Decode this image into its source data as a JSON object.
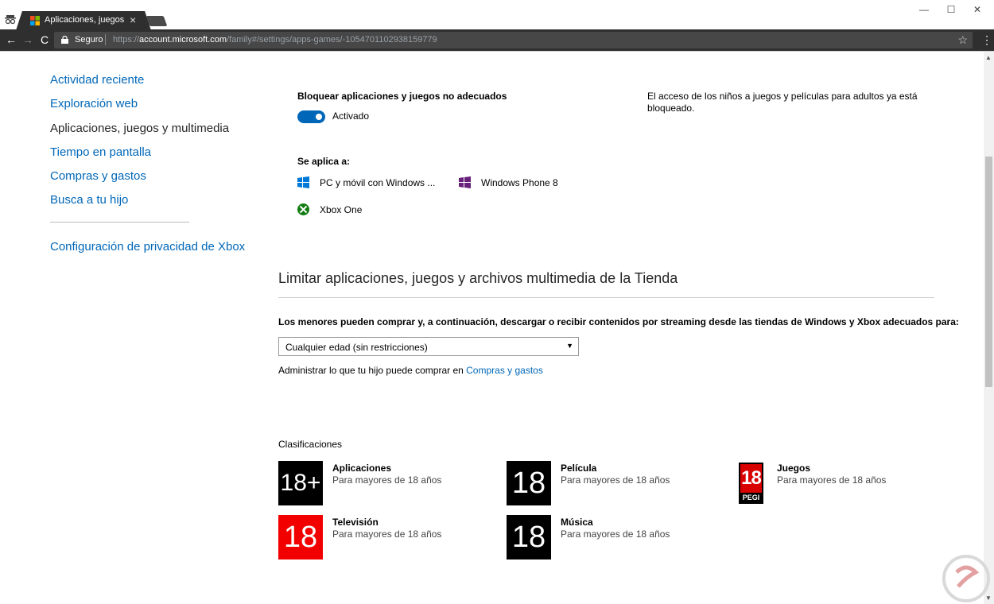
{
  "browser": {
    "tab_title": "Aplicaciones, juegos y m",
    "tab_close": "×",
    "window_controls": {
      "minimize": "—",
      "maximize": "☐",
      "close": "✕"
    },
    "secure_label": "Seguro",
    "url_scheme": "https://",
    "url_host": "account.microsoft.com",
    "url_path": "/family#/settings/apps-games/-1054701102938159779",
    "back": "←",
    "forward": "→",
    "reload": "C",
    "star": "☆",
    "menu": "⋮"
  },
  "sidebar": {
    "items": [
      {
        "label": "Actividad reciente"
      },
      {
        "label": "Exploración web"
      },
      {
        "label": "Aplicaciones, juegos y multimedia"
      },
      {
        "label": "Tiempo en pantalla"
      },
      {
        "label": "Compras y gastos"
      },
      {
        "label": "Busca a tu hijo"
      }
    ],
    "privacy_link": "Configuración de privacidad de Xbox"
  },
  "block": {
    "heading": "Bloquear aplicaciones y juegos no adecuados",
    "toggle_label": "Activado",
    "info": [
      "El acceso de los niños a juegos y películas para adultos ya está",
      "bloqueado."
    ],
    "applies_to": "Se aplica a:",
    "platforms": [
      {
        "label": "PC y móvil con Windows ...",
        "icon": "windows-icon"
      },
      {
        "label": "Windows Phone 8",
        "icon": "windows-phone-icon"
      },
      {
        "label": "Xbox One",
        "icon": "xbox-icon"
      }
    ]
  },
  "store": {
    "title": "Limitar aplicaciones, juegos y archivos multimedia de la Tienda",
    "description": "Los menores pueden comprar y, a continuación, descargar o recibir contenidos por streaming desde las tiendas de Windows y Xbox adecuados para:",
    "select_value": "Cualquier edad (sin restricciones)",
    "manage_text": "Administrar lo que tu hijo puede comprar en",
    "manage_link": "Compras y gastos"
  },
  "ratings": {
    "heading": "Clasificaciones",
    "items": [
      {
        "badge": "18+",
        "title": "Aplicaciones",
        "subtitle": "Para mayores de 18 años"
      },
      {
        "badge": "18",
        "title": "Película",
        "subtitle": "Para mayores de 18 años"
      },
      {
        "badge": "18",
        "badge_label": "PEGI",
        "title": "Juegos",
        "subtitle": "Para mayores de 18 años"
      },
      {
        "badge": "18",
        "title": "Televisión",
        "subtitle": "Para mayores de 18 años"
      },
      {
        "badge": "18",
        "title": "Música",
        "subtitle": "Para mayores de 18 años"
      }
    ]
  },
  "colors": {
    "link": "#0067b8",
    "toggle_on": "#0067b8",
    "rating_red": "#f20000",
    "pegi_red": "#d90000"
  }
}
